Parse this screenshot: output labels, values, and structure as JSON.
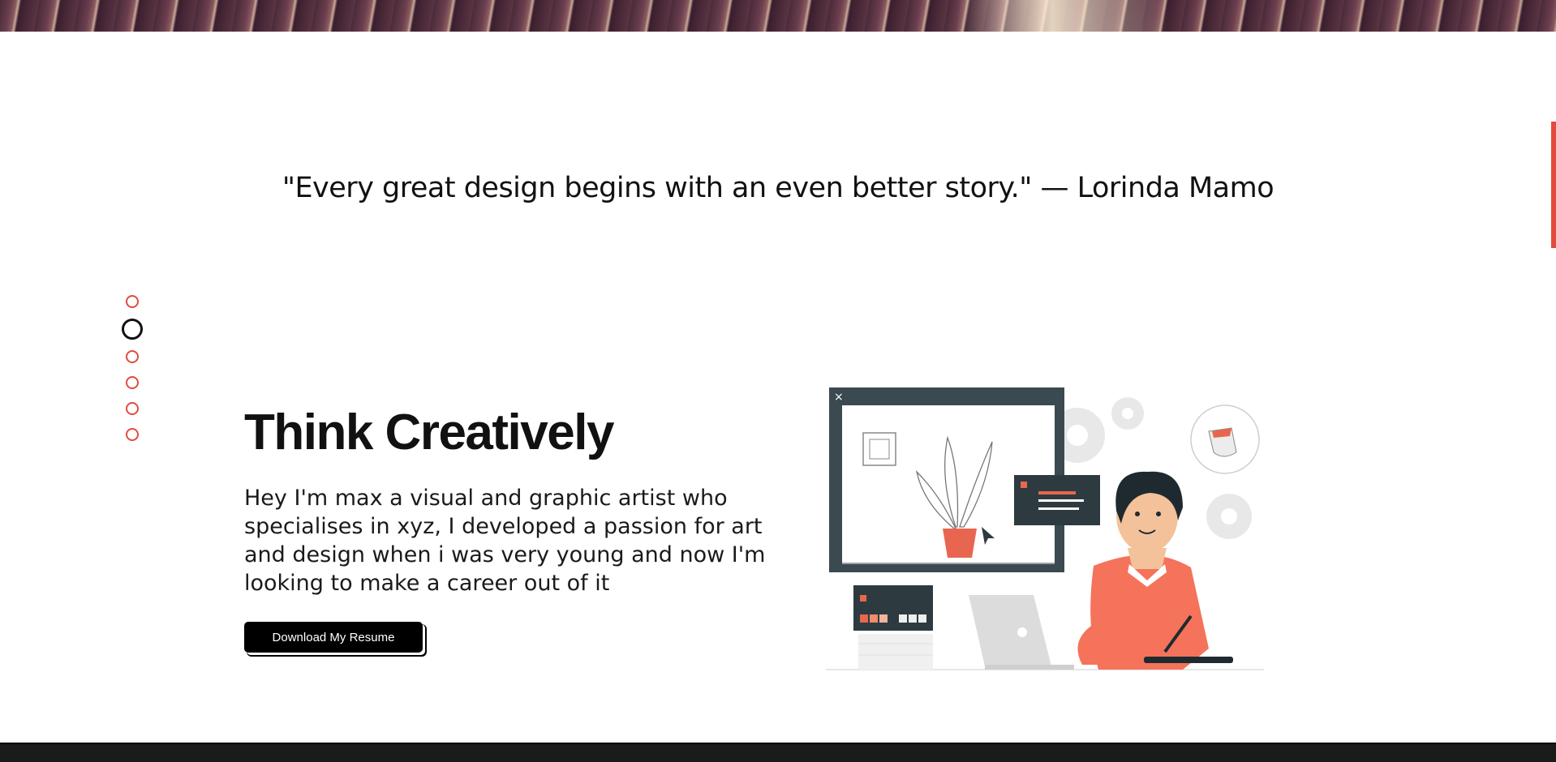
{
  "banner": {
    "alt": "decorative striped header banner"
  },
  "quote": {
    "text": "\"Every great design begins with an even better story.\" — Lorinda Mamo"
  },
  "section_nav": {
    "count": 6,
    "active_index": 1
  },
  "hero": {
    "title": "Think Creatively",
    "bio": "Hey I'm max a visual and graphic artist who specialises in xyz, I developed a passion for art and design when i was very young and now I'm looking to make a career out of it",
    "resume_button": "Download My Resume"
  },
  "colors": {
    "accent": "#e24c3c",
    "text": "#111111",
    "button_bg": "#000000",
    "footer": "#1b1b1b"
  },
  "illustration": {
    "icon": "designer-at-laptop-illustration"
  }
}
